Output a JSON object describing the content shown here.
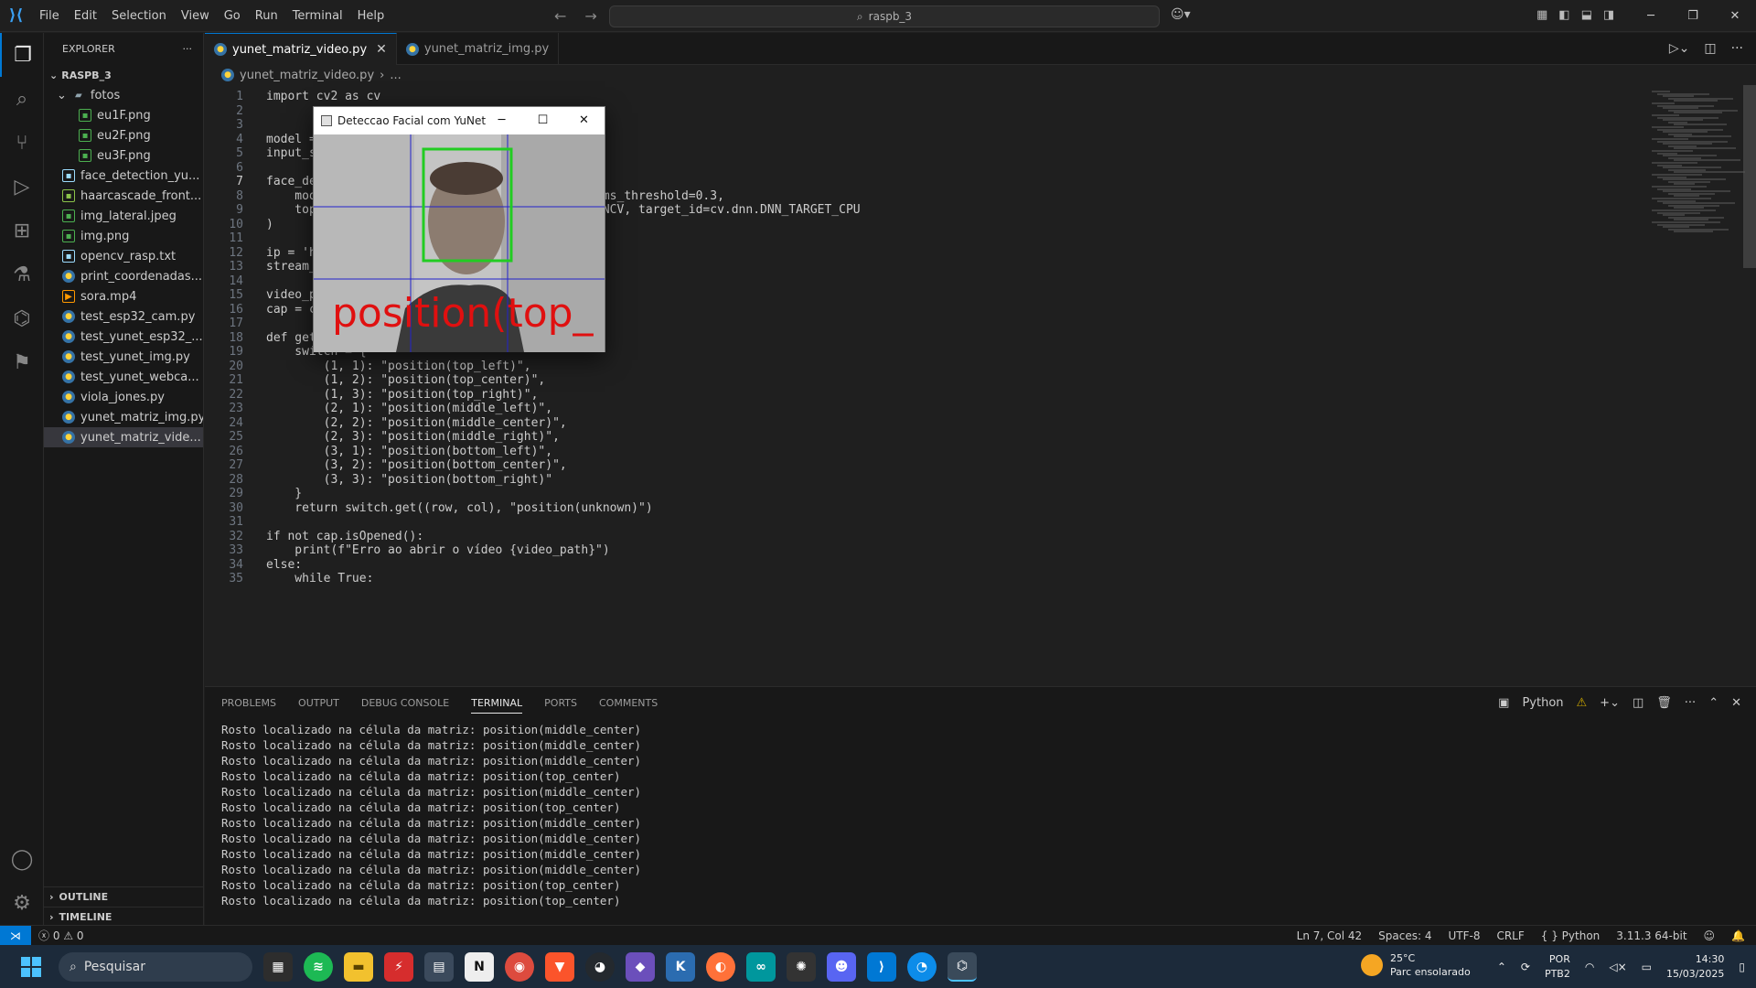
{
  "window": {
    "menu": [
      "File",
      "Edit",
      "Selection",
      "View",
      "Go",
      "Run",
      "Terminal",
      "Help"
    ],
    "search_text": "raspb_3"
  },
  "sidebar": {
    "title": "EXPLORER",
    "root": "RASPB_3",
    "folder": "fotos",
    "folder_files": [
      {
        "name": "eu1F.png",
        "icon": "img"
      },
      {
        "name": "eu2F.png",
        "icon": "img"
      },
      {
        "name": "eu3F.png",
        "icon": "img"
      }
    ],
    "files": [
      {
        "name": "face_detection_yu...",
        "icon": "txt"
      },
      {
        "name": "haarcascade_front...",
        "icon": "xml"
      },
      {
        "name": "img_lateral.jpeg",
        "icon": "img"
      },
      {
        "name": "img.png",
        "icon": "img"
      },
      {
        "name": "opencv_rasp.txt",
        "icon": "txt"
      },
      {
        "name": "print_coordenadas...",
        "icon": "py"
      },
      {
        "name": "sora.mp4",
        "icon": "mp4"
      },
      {
        "name": "test_esp32_cam.py",
        "icon": "py"
      },
      {
        "name": "test_yunet_esp32_...",
        "icon": "py"
      },
      {
        "name": "test_yunet_img.py",
        "icon": "py"
      },
      {
        "name": "test_yunet_webca...",
        "icon": "py"
      },
      {
        "name": "viola_jones.py",
        "icon": "py"
      },
      {
        "name": "yunet_matriz_img.py",
        "icon": "py"
      },
      {
        "name": "yunet_matriz_vide...",
        "icon": "py",
        "selected": true
      }
    ],
    "outline": "OUTLINE",
    "timeline": "TIMELINE"
  },
  "tabs": [
    {
      "label": "yunet_matriz_video.py",
      "active": true
    },
    {
      "label": "yunet_matriz_img.py",
      "active": false
    }
  ],
  "breadcrumb": {
    "file": "yunet_matriz_video.py",
    "rest": "..."
  },
  "code_lines": [
    {
      "n": "1",
      "text": "import cv2 as cv"
    },
    {
      "n": "2",
      "text": ""
    },
    {
      "n": "3",
      "text": ""
    },
    {
      "n": "4",
      "text": "model ="
    },
    {
      "n": "5",
      "text": "input_s"
    },
    {
      "n": "6",
      "text": ""
    },
    {
      "n": "7",
      "text": "face_de"
    },
    {
      "n": "8",
      "text": "    mod                                       nms_threshold=0.3,"
    },
    {
      "n": "9",
      "text": "    top                                       ENCV, target_id=cv.dnn.DNN_TARGET_CPU"
    },
    {
      "n": "10",
      "text": ")"
    },
    {
      "n": "11",
      "text": ""
    },
    {
      "n": "12",
      "text": "ip = 'h"
    },
    {
      "n": "13",
      "text": "stream_"
    },
    {
      "n": "14",
      "text": ""
    },
    {
      "n": "15",
      "text": "video_p"
    },
    {
      "n": "16",
      "text": "cap = cv.VideoCapture(stream_url)"
    },
    {
      "n": "17",
      "text": ""
    },
    {
      "n": "18",
      "text": "def get_position(row, col):"
    },
    {
      "n": "19",
      "text": "    switch = {"
    },
    {
      "n": "20",
      "text": "        (1, 1): \"position(top_left)\","
    },
    {
      "n": "21",
      "text": "        (1, 2): \"position(top_center)\","
    },
    {
      "n": "22",
      "text": "        (1, 3): \"position(top_right)\","
    },
    {
      "n": "23",
      "text": "        (2, 1): \"position(middle_left)\","
    },
    {
      "n": "24",
      "text": "        (2, 2): \"position(middle_center)\","
    },
    {
      "n": "25",
      "text": "        (2, 3): \"position(middle_right)\","
    },
    {
      "n": "26",
      "text": "        (3, 1): \"position(bottom_left)\","
    },
    {
      "n": "27",
      "text": "        (3, 2): \"position(bottom_center)\","
    },
    {
      "n": "28",
      "text": "        (3, 3): \"position(bottom_right)\""
    },
    {
      "n": "29",
      "text": "    }"
    },
    {
      "n": "30",
      "text": "    return switch.get((row, col), \"position(unknown)\")"
    },
    {
      "n": "31",
      "text": ""
    },
    {
      "n": "32",
      "text": "if not cap.isOpened():"
    },
    {
      "n": "33",
      "text": "    print(f\"Erro ao abrir o vídeo {video_path}\")"
    },
    {
      "n": "34",
      "text": "else:"
    },
    {
      "n": "35",
      "text": "    while True:"
    }
  ],
  "panel": {
    "tabs": [
      "PROBLEMS",
      "OUTPUT",
      "DEBUG CONSOLE",
      "TERMINAL",
      "PORTS",
      "COMMENTS"
    ],
    "active_tab": "TERMINAL",
    "terminal_name": "Python",
    "terminal_lines": [
      "Rosto localizado na célula da matriz: position(middle_center)",
      "Rosto localizado na célula da matriz: position(middle_center)",
      "Rosto localizado na célula da matriz: position(middle_center)",
      "Rosto localizado na célula da matriz: position(top_center)",
      "Rosto localizado na célula da matriz: position(middle_center)",
      "Rosto localizado na célula da matriz: position(top_center)",
      "Rosto localizado na célula da matriz: position(middle_center)",
      "Rosto localizado na célula da matriz: position(middle_center)",
      "Rosto localizado na célula da matriz: position(middle_center)",
      "Rosto localizado na célula da matriz: position(middle_center)",
      "Rosto localizado na célula da matriz: position(top_center)",
      "Rosto localizado na célula da matriz: position(top_center)"
    ]
  },
  "statusbar": {
    "errors": "0",
    "warnings": "0",
    "position": "Ln 7, Col 42",
    "spaces": "Spaces: 4",
    "encoding": "UTF-8",
    "eol": "CRLF",
    "language": "Python",
    "interpreter": "3.11.3 64-bit"
  },
  "popup": {
    "title": "Deteccao Facial com YuNet",
    "overlay_text": "position(top_"
  },
  "taskbar": {
    "search_placeholder": "Pesquisar",
    "weather_temp": "25°C",
    "weather_desc": "Parc ensolarado",
    "lang": "POR",
    "layout": "PTB2",
    "time": "14:30",
    "date": "15/03/2025"
  },
  "colors": {
    "accent": "#0078d4",
    "face_box": "#22cc22",
    "grid_lines": "#2222cc",
    "overlay_text": "#e01010"
  }
}
